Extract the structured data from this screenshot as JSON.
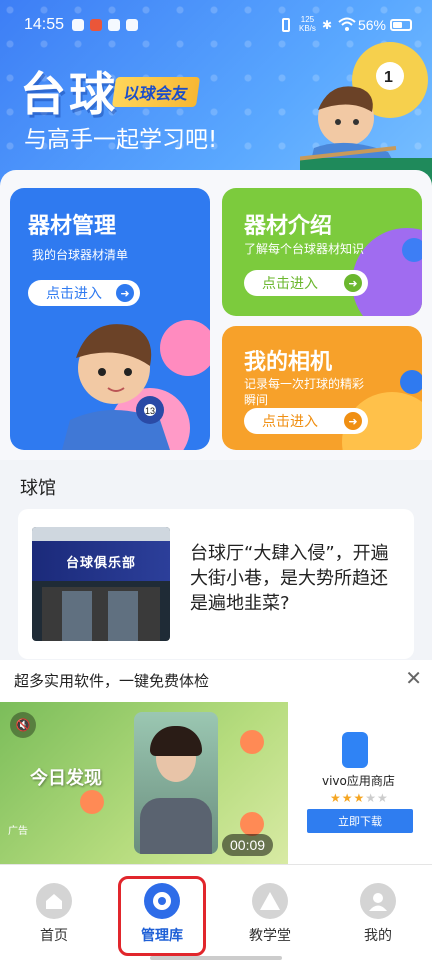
{
  "status_bar": {
    "time": "14:55",
    "net_speed_top": "125",
    "net_speed_bottom": "KB/s",
    "battery": "56%"
  },
  "banner": {
    "title": "台球",
    "tag": "以球会友",
    "subtitle": "与高手一起学习吧!"
  },
  "cards": {
    "equipment_manage": {
      "title": "器材管理",
      "desc": "我的台球器材清单",
      "button": "点击进入",
      "color": "#2f7af0"
    },
    "equipment_intro": {
      "title": "器材介绍",
      "desc": "了解每个台球器材知识",
      "button": "点击进入",
      "color": "#7ccb3d"
    },
    "my_camera": {
      "title": "我的相机",
      "desc_line1": "记录每一次打球的精彩",
      "desc_line2": "瞬间",
      "button": "点击进入",
      "color": "#f7a12a"
    }
  },
  "section": {
    "title": "球馆"
  },
  "news": {
    "headline": "台球厅“大肆入侵”，开遍大街小巷，是大势所趋还是遍地韭菜?",
    "image_sign": "台球俱乐部"
  },
  "ad": {
    "header": "超多实用软件，一键免费体检",
    "video_label": "今日发现",
    "ad_badge": "广告",
    "duration": "00:09",
    "store_name": "vivo应用商店",
    "rating": 3,
    "download": "立即下载"
  },
  "tabbar": {
    "items": [
      "首页",
      "管理库",
      "教学堂",
      "我的"
    ],
    "selected": 1
  }
}
